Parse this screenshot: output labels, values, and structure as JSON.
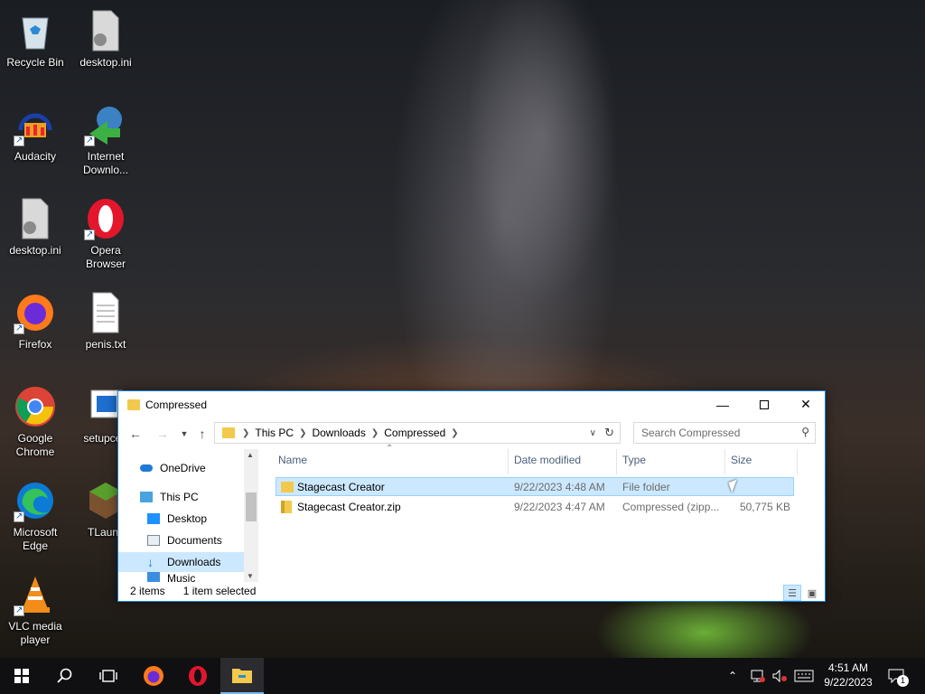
{
  "desktop": {
    "icons": [
      {
        "label": "Recycle Bin",
        "icon": "recycle-bin-icon"
      },
      {
        "label": "desktop.ini",
        "icon": "settings-file-icon"
      },
      {
        "label": "Audacity",
        "icon": "audacity-icon"
      },
      {
        "label": "Internet Downlo...",
        "icon": "internet-download-manager-icon"
      },
      {
        "label": "desktop.ini",
        "icon": "settings-file-icon"
      },
      {
        "label": "Opera Browser",
        "icon": "opera-icon"
      },
      {
        "label": "Firefox",
        "icon": "firefox-icon"
      },
      {
        "label": "penis.txt",
        "icon": "text-file-icon"
      },
      {
        "label": "Google Chrome",
        "icon": "chrome-icon"
      },
      {
        "label": "setupcert",
        "icon": "installer-icon"
      },
      {
        "label": "Microsoft Edge",
        "icon": "edge-icon"
      },
      {
        "label": "TLaunc",
        "icon": "minecraft-icon"
      },
      {
        "label": "VLC media player",
        "icon": "vlc-icon"
      }
    ]
  },
  "window": {
    "title": "Compressed",
    "address": {
      "crumbs": [
        "This PC",
        "Downloads",
        "Compressed"
      ]
    },
    "search_placeholder": "Search Compressed",
    "nav_items": [
      {
        "label": "OneDrive",
        "icon": "onedrive-icon"
      },
      {
        "label": "This PC",
        "icon": "computer-icon"
      },
      {
        "label": "Desktop",
        "icon": "desktop-folder-icon"
      },
      {
        "label": "Documents",
        "icon": "documents-icon"
      },
      {
        "label": "Downloads",
        "icon": "downloads-icon",
        "selected": true
      },
      {
        "label": "Music",
        "icon": "music-icon"
      }
    ],
    "columns": [
      "Name",
      "Date modified",
      "Type",
      "Size"
    ],
    "files": [
      {
        "name": "Stagecast Creator",
        "date": "9/22/2023 4:48 AM",
        "type": "File folder",
        "size": "",
        "selected": true
      },
      {
        "name": "Stagecast Creator.zip",
        "date": "9/22/2023 4:47 AM",
        "type": "Compressed (zipp...",
        "size": "50,775 KB",
        "selected": false
      }
    ],
    "status": {
      "items": "2 items",
      "selected": "1 item selected"
    }
  },
  "taskbar": {
    "time": "4:51 AM",
    "date": "9/22/2023",
    "notification_count": "1"
  }
}
